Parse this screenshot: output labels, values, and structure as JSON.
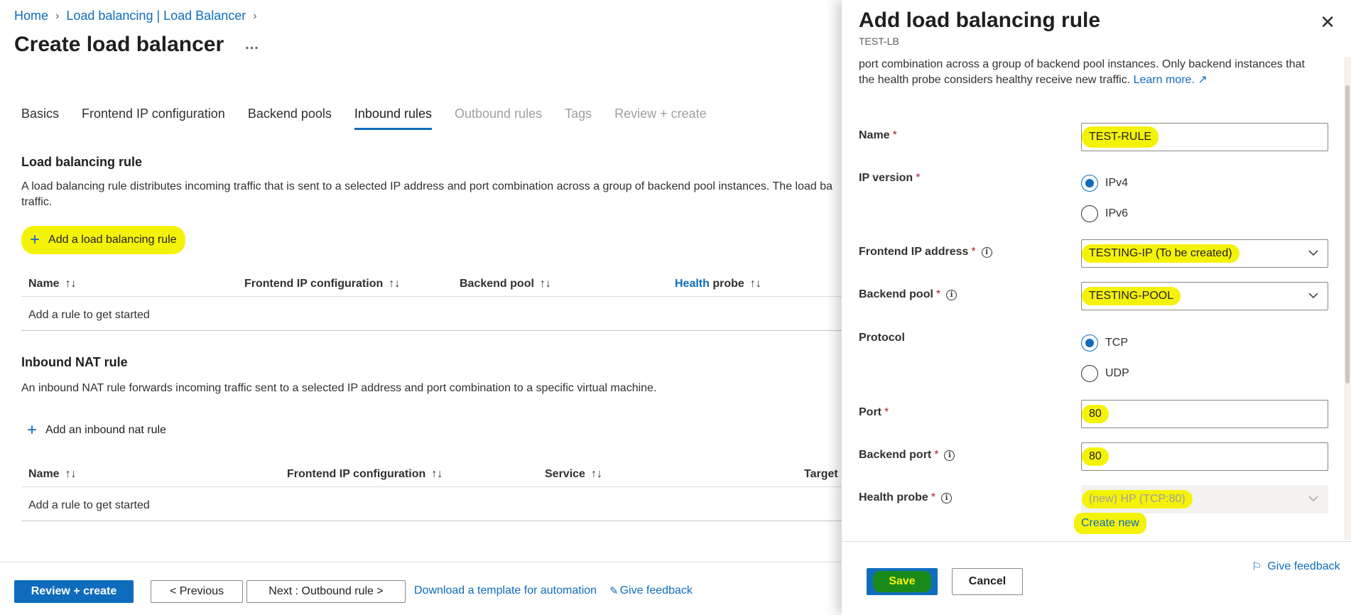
{
  "breadcrumb": {
    "home": "Home",
    "parent": "Load balancing | Load Balancer"
  },
  "page": {
    "title": "Create load balancer",
    "more": "..."
  },
  "tabs": [
    {
      "label": "Basics"
    },
    {
      "label": "Frontend IP configuration"
    },
    {
      "label": "Backend pools"
    },
    {
      "label": "Inbound rules"
    },
    {
      "label": "Outbound rules"
    },
    {
      "label": "Tags"
    },
    {
      "label": "Review + create"
    }
  ],
  "lb_rule": {
    "title": "Load balancing rule",
    "desc_line1": "A load balancing rule distributes incoming traffic that is sent to a selected IP address and port combination across a group of backend pool instances. The load ba",
    "desc_line2": "traffic.",
    "add_label": "Add a load balancing rule",
    "columns": [
      "Name",
      "Frontend IP configuration",
      "Backend pool",
      "Health",
      "probe"
    ],
    "empty": "Add a rule to get started"
  },
  "nat_rule": {
    "title": "Inbound NAT rule",
    "desc": "An inbound NAT rule forwards incoming traffic sent to a selected IP address and port combination to a specific virtual machine.",
    "add_label": "Add an inbound nat rule",
    "columns": [
      "Name",
      "Frontend IP configuration",
      "Service",
      "Target"
    ],
    "empty": "Add a rule to get started"
  },
  "footer": {
    "review_create": "Review + create",
    "previous": "< Previous",
    "next": "Next : Outbound rule >",
    "download": "Download a template for automation",
    "feedback": "Give feedback"
  },
  "panel": {
    "title": "Add load balancing rule",
    "subtitle": "TEST-LB",
    "desc": "port combination across a group of backend pool instances. Only backend instances that the health probe considers healthy receive new traffic.",
    "learn_more": "Learn more.",
    "fields": {
      "name": {
        "label": "Name",
        "value": "TEST-RULE"
      },
      "ip_version": {
        "label": "IP version",
        "options": [
          "IPv4",
          "IPv6"
        ],
        "selected": "IPv4"
      },
      "frontend_ip": {
        "label": "Frontend IP address",
        "value": "TESTING-IP (To be created)"
      },
      "backend_pool": {
        "label": "Backend pool",
        "value": "TESTING-POOL"
      },
      "protocol": {
        "label": "Protocol",
        "options": [
          "TCP",
          "UDP"
        ],
        "selected": "TCP"
      },
      "port": {
        "label": "Port",
        "value": "80"
      },
      "backend_port": {
        "label": "Backend port",
        "value": "80"
      },
      "health_probe": {
        "label": "Health probe",
        "value": "(new) HP (TCP:80)",
        "create_new": "Create new"
      }
    },
    "save": "Save",
    "cancel": "Cancel",
    "feedback": "Give feedback"
  },
  "colors": {
    "accent": "#0f6cbd",
    "highlight": "#f5f20a",
    "required": "#a4262c"
  }
}
